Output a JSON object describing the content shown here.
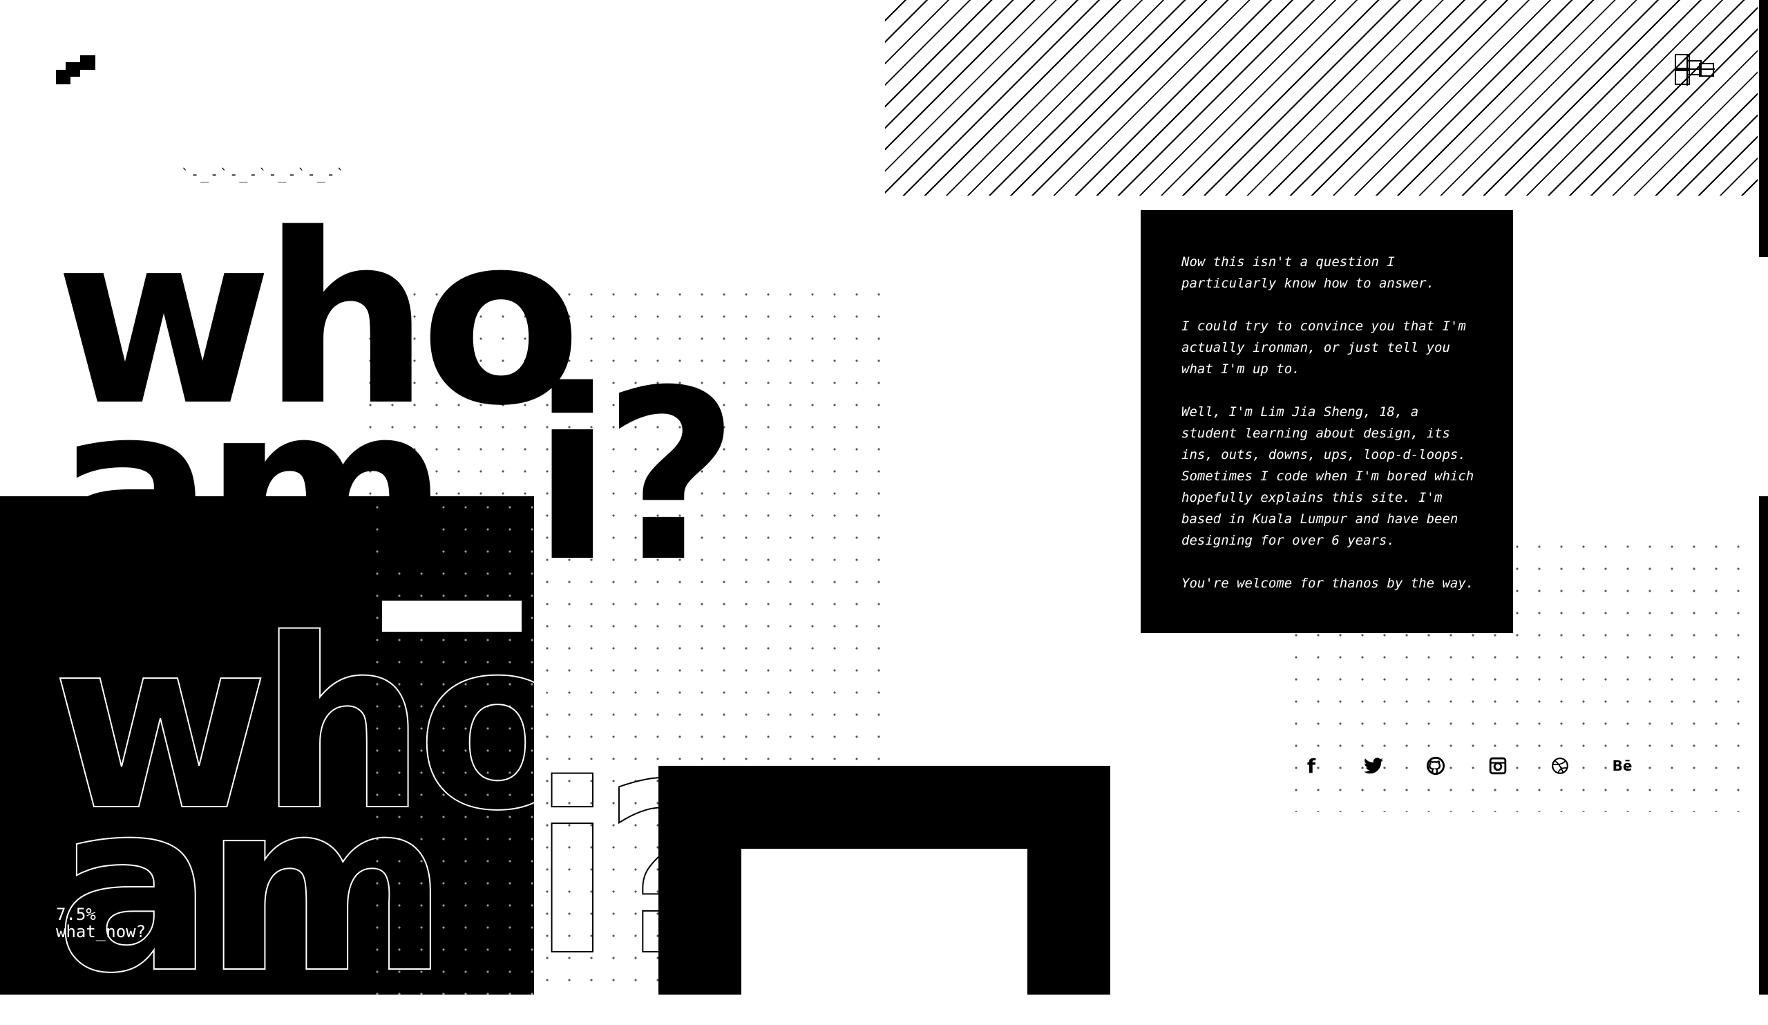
{
  "header": {
    "logo_icon": "pixel-logo-icon",
    "menu_icon": "hash-grid-menu-icon",
    "wave_decoration": "`-_-`-_-`-_-`-_-`"
  },
  "hero": {
    "line1": "who",
    "line2": "am",
    "cursor": "_",
    "line3": "i?",
    "outline_line1": "who",
    "outline_line2": "am",
    "outline_line3": "i?"
  },
  "about": {
    "paragraphs": [
      "Now this isn't a question I particularly know how to answer.",
      "I could try to convince you that I'm actually ironman, or just tell you what I'm up to.",
      "Well, I'm Lim Jia Sheng, 18, a student learning about design, its ins, outs, downs, ups, loop-d-loops. Sometimes I code when I'm bored which hopefully explains this site. I'm based in Kuala Lumpur and have been designing for over 6 years.",
      "You're welcome for thanos by the way."
    ]
  },
  "social": {
    "facebook": "f",
    "twitter": "twitter-icon",
    "github": "github-icon",
    "instagram": "instagram-icon",
    "dribbble": "dribbble-icon",
    "behance": "Bē"
  },
  "status": {
    "progress": "7.5%",
    "prompt": "what_now?"
  }
}
